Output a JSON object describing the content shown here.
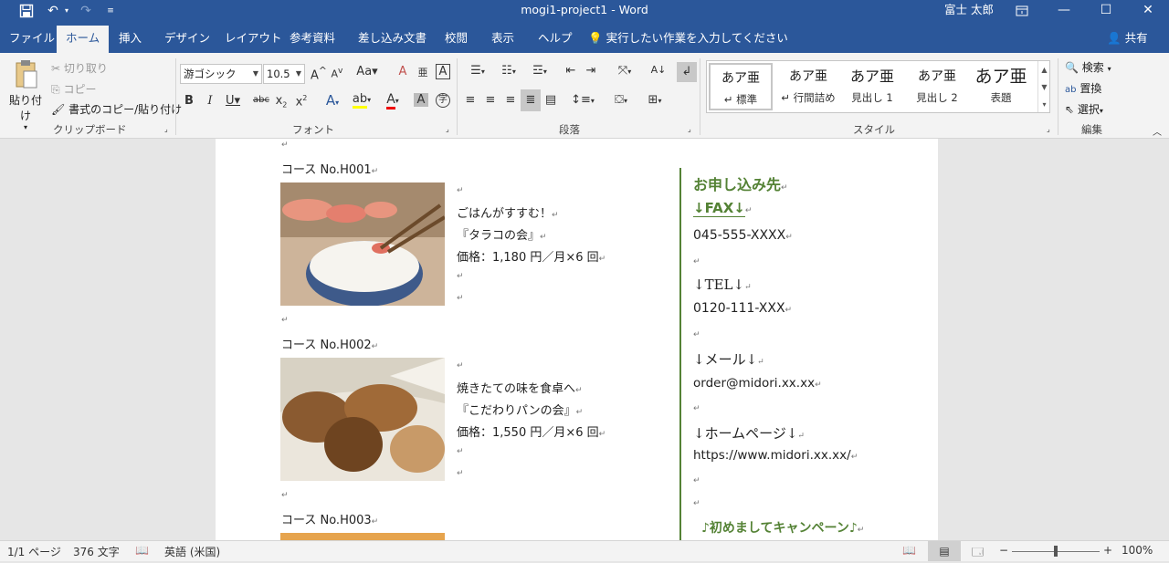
{
  "window": {
    "title": "mogi1-project1  -  Word",
    "user": "富士 太郎"
  },
  "tabs": [
    {
      "label": "ファイル"
    },
    {
      "label": "ホーム"
    },
    {
      "label": "挿入"
    },
    {
      "label": "デザイン"
    },
    {
      "label": "レイアウト"
    },
    {
      "label": "参考資料"
    },
    {
      "label": "差し込み文書"
    },
    {
      "label": "校閲"
    },
    {
      "label": "表示"
    },
    {
      "label": "ヘルプ"
    }
  ],
  "tell_me": "実行したい作業を入力してください",
  "share": "共有",
  "clipboard": {
    "paste": "貼り付け",
    "cut": "切り取り",
    "copy": "コピー",
    "format_painter": "書式のコピー/貼り付け",
    "group": "クリップボード"
  },
  "font": {
    "name": "游ゴシック",
    "size": "10.5",
    "group": "フォント"
  },
  "paragraph": {
    "group": "段落"
  },
  "styles": {
    "group": "スタイル",
    "items": [
      {
        "sample": "あア亜",
        "name": "↵ 標準"
      },
      {
        "sample": "あア亜",
        "name": "↵ 行間詰め"
      },
      {
        "sample": "あア亜",
        "name": "見出し 1"
      },
      {
        "sample": "あア亜",
        "name": "見出し 2"
      },
      {
        "sample": "あア亜",
        "name": "表題"
      }
    ]
  },
  "editing": {
    "find": "検索",
    "replace": "置換",
    "select": "選択",
    "group": "編集"
  },
  "doc": {
    "left": {
      "course1": {
        "label": "コース No.H001",
        "line1": "ごはんがすすむ！",
        "line2": "『タラコの会』",
        "line3": "価格：1,180 円／月×6 回"
      },
      "course2": {
        "label": "コース No.H002",
        "line1": "焼きたての味を食卓へ",
        "line2": "『こだわりパンの会』",
        "line3": "価格：1,550 円／月×6 回"
      },
      "course3": {
        "label": "コース No.H003"
      }
    },
    "right": {
      "heading": "お申し込み先",
      "fax_label": "↓FAX↓",
      "fax": "045-555-XXXX",
      "tel_label": "↓TEL↓",
      "tel": "0120-111-XXX",
      "mail_label": "↓メール↓",
      "mail": "order@midori.xx.xx",
      "hp_label": "↓ホームページ↓",
      "hp": "https://www.midori.xx.xx/",
      "campaign": "♪初めましてキャンペーン♪"
    },
    "mark": "↵"
  },
  "status": {
    "page": "1/1 ページ",
    "words": "376 文字",
    "lang": "英語 (米国)",
    "zoom": "100%"
  },
  "colors": {
    "accent": "#2b579a",
    "green": "#548235"
  }
}
